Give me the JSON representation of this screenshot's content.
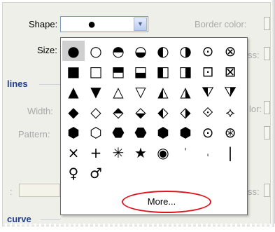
{
  "form": {
    "shape_label": "Shape:",
    "size_label": "Size:",
    "border_color_label": "Border color:",
    "shape_value": "●",
    "lines_section": "lines",
    "width_label": "Width:",
    "pattern_label": "Pattern:",
    "curve_section": "curve",
    "color_label_partial": "lor:",
    "ss_label_partial_1": "ss:",
    "ss_label_partial_2": "ss:",
    "colon_partial": ":"
  },
  "popup": {
    "rows": [
      [
        "●",
        "○",
        "◓",
        "◒",
        "◐",
        "◑",
        "⊙",
        "⊗"
      ],
      [
        "■",
        "□",
        "⬒",
        "⬓",
        "◧",
        "◨",
        "⊡",
        "⊠"
      ],
      [
        "▲",
        "▼",
        "△",
        "▽",
        "◭",
        "◮",
        "⧨",
        "⧩"
      ],
      [
        "◆",
        "◇",
        "⬘",
        "⬙",
        "⬖",
        "⬗",
        "⟐",
        "⟡"
      ],
      [
        "⬢",
        "⬡",
        "⬣",
        "⬣",
        "⬢",
        "⬢",
        "⊙",
        "⊛"
      ],
      [
        "×",
        "+",
        "✳",
        "★",
        "◉",
        "ˈ",
        "ˌ",
        "|"
      ],
      [
        "♀",
        "♂",
        "",
        "",
        "",
        "",
        "",
        ""
      ]
    ],
    "more_label": "More..."
  },
  "colors": {
    "accent": "#1f3f8f",
    "highlight": "#e0141e",
    "panel_bg": "#efefe9"
  }
}
